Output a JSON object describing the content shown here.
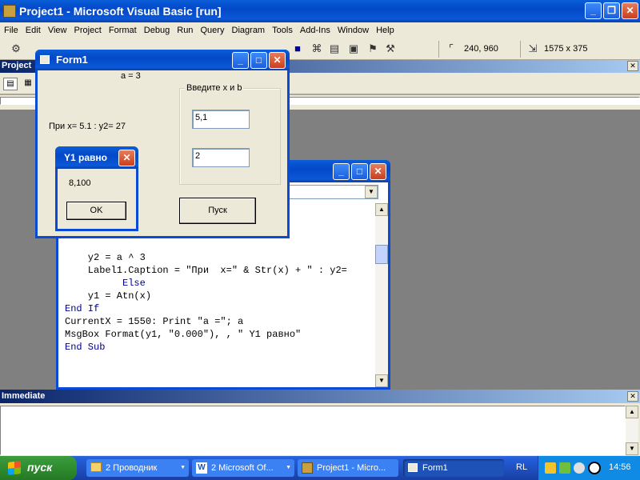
{
  "main_window": {
    "title": "Project1 - Microsoft Visual Basic [run]",
    "menu": [
      "File",
      "Edit",
      "View",
      "Project",
      "Format",
      "Debug",
      "Run",
      "Query",
      "Diagram",
      "Tools",
      "Add-Ins",
      "Window",
      "Help"
    ],
    "toolbar": {
      "position": "240, 960",
      "size": "1575 x 375"
    }
  },
  "project_panel": {
    "title": "Project"
  },
  "code_window": {
    "lines": [
      "    y2 = a ^ 3",
      "    Label1.Caption = \"При  x=\" & Str(x) + \" : y2=",
      "          Else",
      "    y1 = Atn(x)",
      "End If",
      "CurrentX = 1550: Print \"a =\"; a",
      "MsgBox Format(y1, \"0.000\"), , \" Y1 равно\"",
      "End Sub"
    ]
  },
  "form1": {
    "title": "Form1",
    "print_text": "a = 3",
    "label1": "При  x= 5.1 : y2= 27",
    "frame_caption": "Введите x и b",
    "text_x": "5,1",
    "text_b": "2",
    "start_button": "Пуск"
  },
  "msgbox": {
    "title": "Y1 равно",
    "message": "8,100",
    "ok": "OK"
  },
  "immediate": {
    "title": "Immediate"
  },
  "taskbar": {
    "start": "пуск",
    "tasks": [
      {
        "label": "2 Проводник"
      },
      {
        "label": "2 Microsoft Of..."
      },
      {
        "label": "Project1 - Micro..."
      },
      {
        "label": "Form1"
      }
    ],
    "lang": "RL",
    "clock": "14:56"
  }
}
